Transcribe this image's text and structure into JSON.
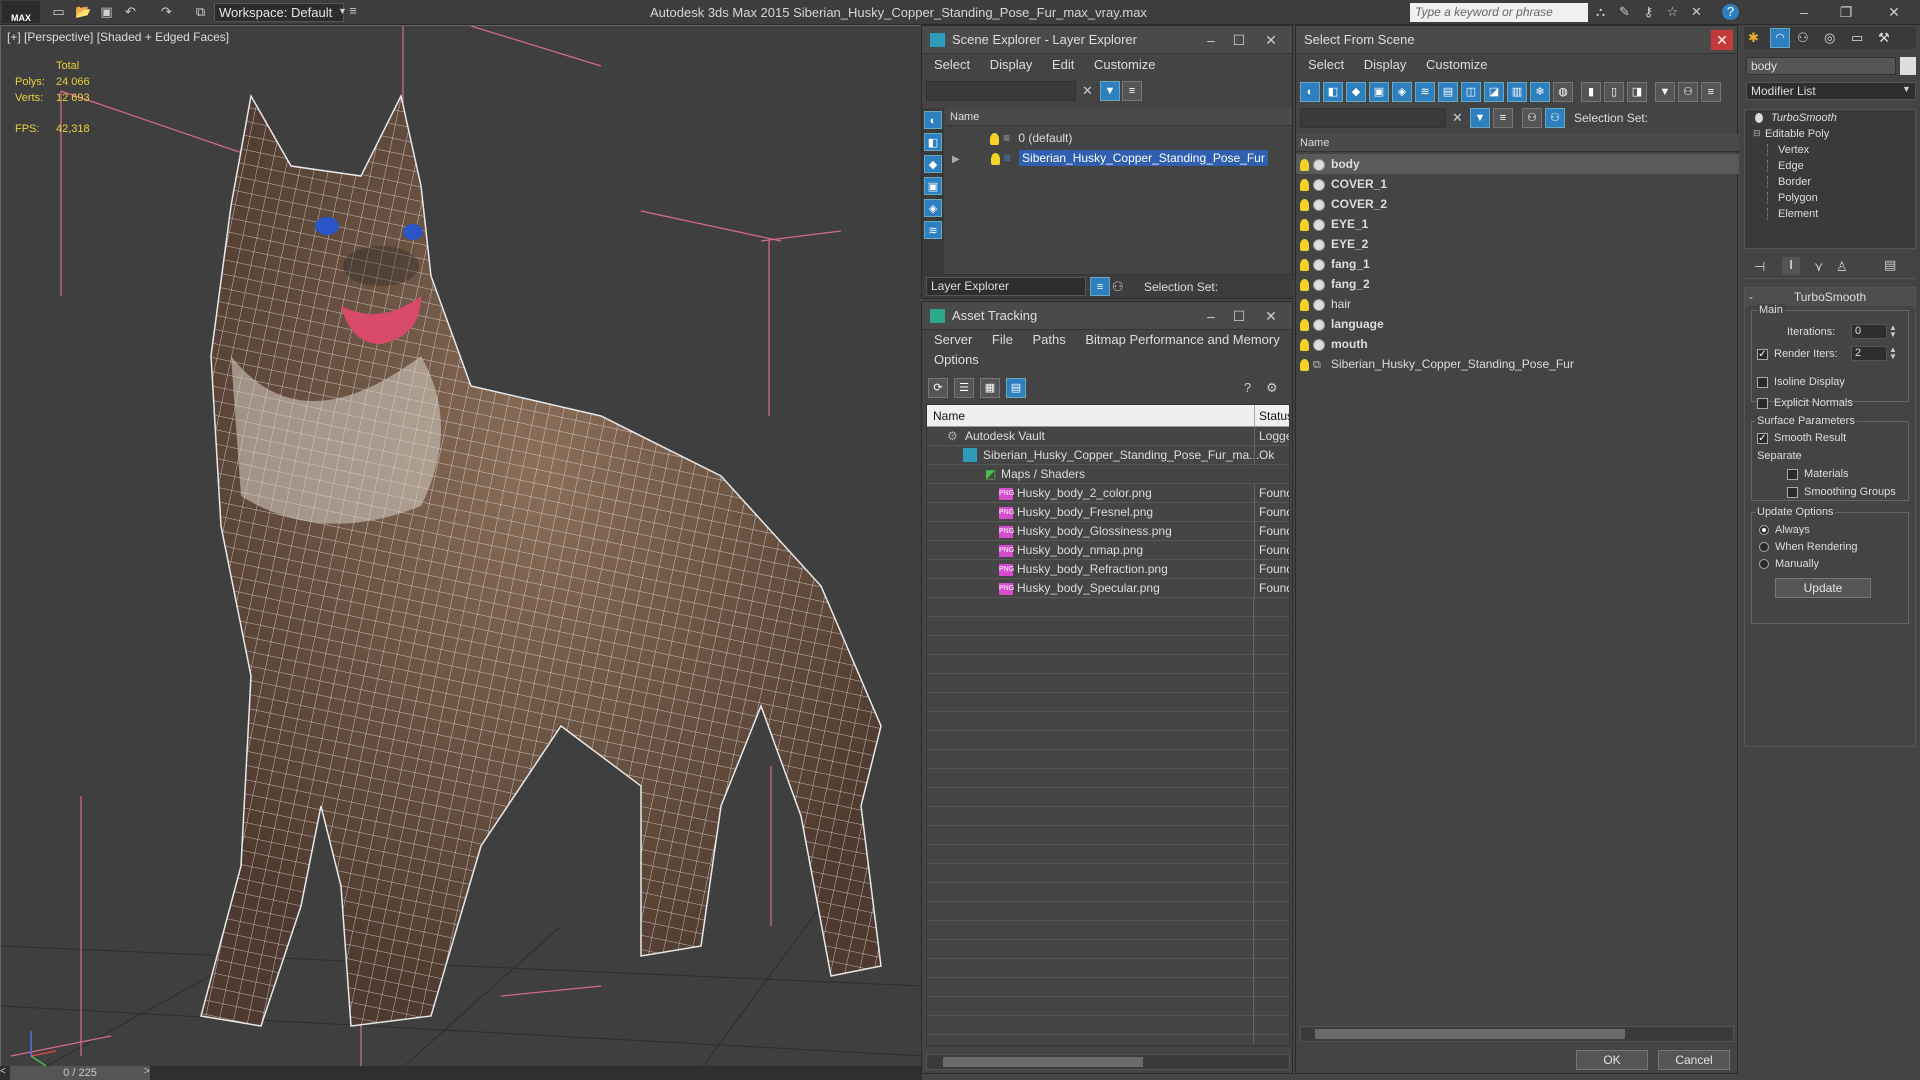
{
  "app": {
    "title": "Autodesk 3ds Max  2015    Siberian_Husky_Copper_Standing_Pose_Fur_max_vray.max",
    "logo": "MAX",
    "workspace": "Workspace: Default",
    "search_placeholder": "Type a keyword or phrase"
  },
  "viewport": {
    "label": "[+] [Perspective] [Shaded + Edged Faces]",
    "stats": {
      "total_label": "Total",
      "polys_label": "Polys:",
      "polys_value": "24 066",
      "verts_label": "Verts:",
      "verts_value": "12 693",
      "fps_label": "FPS:",
      "fps_value": "42,318"
    },
    "time_slider": "0 / 225"
  },
  "scene_explorer": {
    "title": "Scene Explorer - Layer Explorer",
    "menu": [
      "Select",
      "Display",
      "Edit",
      "Customize"
    ],
    "column_name": "Name",
    "layers": [
      {
        "name": "0 (default)",
        "selected": false
      },
      {
        "name": "Siberian_Husky_Copper_Standing_Pose_Fur",
        "selected": true
      }
    ],
    "explorer_dropdown": "Layer Explorer",
    "selection_set_label": "Selection Set:"
  },
  "asset_tracking": {
    "title": "Asset Tracking",
    "menu": [
      "Server",
      "File",
      "Paths",
      "Bitmap Performance and Memory",
      "Options"
    ],
    "columns": [
      "Name",
      "Status"
    ],
    "rows": [
      {
        "name": "Autodesk Vault",
        "status": "Logged"
      },
      {
        "name": "Siberian_Husky_Copper_Standing_Pose_Fur_ma...",
        "status": "Ok"
      },
      {
        "name": "Maps / Shaders",
        "status": ""
      },
      {
        "name": "Husky_body_2_color.png",
        "status": "Found"
      },
      {
        "name": "Husky_body_Fresnel.png",
        "status": "Found"
      },
      {
        "name": "Husky_body_Glossiness.png",
        "status": "Found"
      },
      {
        "name": "Husky_body_nmap.png",
        "status": "Found"
      },
      {
        "name": "Husky_body_Refraction.png",
        "status": "Found"
      },
      {
        "name": "Husky_body_Specular.png",
        "status": "Found"
      }
    ]
  },
  "select_from_scene": {
    "title": "Select From Scene",
    "menu": [
      "Select",
      "Display",
      "Customize"
    ],
    "selection_set_label": "Selection Set:",
    "column_name": "Name",
    "objects": [
      {
        "name": "body",
        "bold": true,
        "highlighted": true
      },
      {
        "name": "COVER_1",
        "bold": true
      },
      {
        "name": "COVER_2",
        "bold": true
      },
      {
        "name": "EYE_1",
        "bold": true
      },
      {
        "name": "EYE_2",
        "bold": true
      },
      {
        "name": "fang_1",
        "bold": true
      },
      {
        "name": "fang_2",
        "bold": true
      },
      {
        "name": "hair",
        "bold": false
      },
      {
        "name": "language",
        "bold": true
      },
      {
        "name": "mouth",
        "bold": true
      },
      {
        "name": "Siberian_Husky_Copper_Standing_Pose_Fur",
        "bold": false
      }
    ],
    "ok_label": "OK",
    "cancel_label": "Cancel"
  },
  "command_panel": {
    "object_name": "body",
    "modifier_list": "Modifier List",
    "stack": [
      "TurboSmooth",
      "Editable Poly",
      "Vertex",
      "Edge",
      "Border",
      "Polygon",
      "Element"
    ],
    "rollout_title": "TurboSmooth",
    "main_label": "Main",
    "iterations_label": "Iterations:",
    "iterations_value": "0",
    "render_iters_label": "Render Iters:",
    "render_iters_value": "2",
    "isoline_label": "Isoline Display",
    "explicit_normals_label": "Explicit Normals",
    "surface_params_label": "Surface Parameters",
    "smooth_result_label": "Smooth Result",
    "separate_label": "Separate",
    "materials_label": "Materials",
    "smoothing_groups_label": "Smoothing Groups",
    "update_options_label": "Update Options",
    "always_label": "Always",
    "when_rendering_label": "When Rendering",
    "manually_label": "Manually",
    "update_button": "Update"
  },
  "colors": {
    "accent_blue": "#2d7fbf",
    "selection": "#2f5fae",
    "stats_yellow": "#e8d23c"
  }
}
